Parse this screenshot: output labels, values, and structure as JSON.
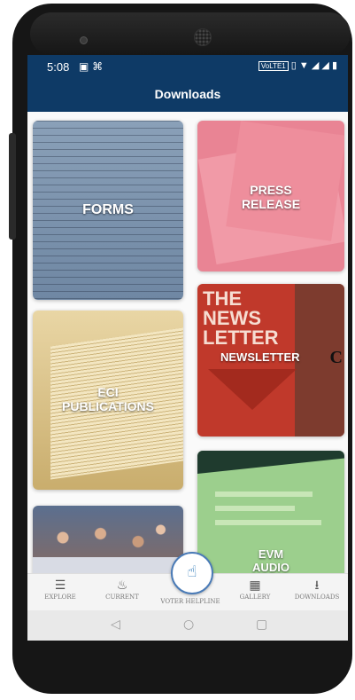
{
  "status_bar": {
    "time": "5:08",
    "left_icons": [
      "image-icon",
      "usb-icon"
    ],
    "right_text": "VoLTE1"
  },
  "appbar": {
    "title": "Downloads"
  },
  "cards": {
    "forms": "FORMS",
    "press_release": "PRESS\nRELEASE",
    "eci_publications": "ECI\nPUBLICATIONS",
    "newsletter": "NEWSLETTER",
    "newsletter_art": "THE\nNEWS\nLETTER",
    "evm_audio": "EVM\nAUDIO"
  },
  "bottom_nav": {
    "explore": "EXPLORE",
    "current": "CURRENT",
    "voter_helpline": "VOTER HELPLINE",
    "gallery": "GALLERY",
    "downloads": "DOWNLOADS"
  },
  "colors": {
    "appbar": "#0e3a66",
    "forms": "#7d93ad",
    "press": "#e98494",
    "publications": "#d9c38a",
    "newsletter": "#c0392b",
    "evm": "#9ccf8d"
  }
}
